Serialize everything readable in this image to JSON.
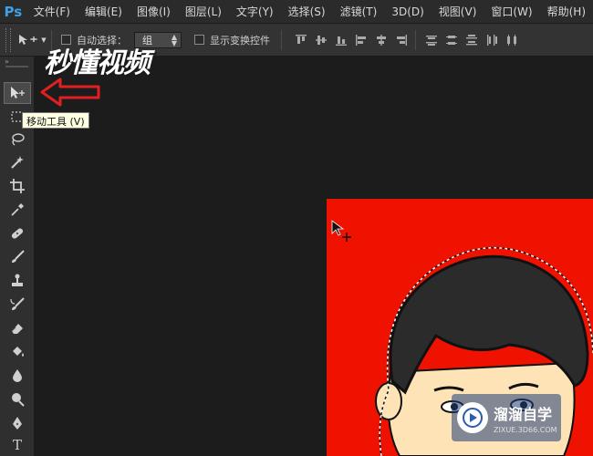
{
  "app": {
    "logo": "Ps",
    "accent": "#3ea0e8"
  },
  "menu": [
    "文件(F)",
    "编辑(E)",
    "图像(I)",
    "图层(L)",
    "文字(Y)",
    "选择(S)",
    "滤镜(T)",
    "3D(D)",
    "视图(V)",
    "窗口(W)",
    "帮助(H)"
  ],
  "options": {
    "auto_select_label": "自动选择：",
    "auto_select_value": "组",
    "show_transform_label": "显示变换控件"
  },
  "tools": [
    {
      "name": "move-tool",
      "icon": "move-icon"
    },
    {
      "name": "marquee-tool",
      "icon": "marquee-icon"
    },
    {
      "name": "lasso-tool",
      "icon": "lasso-icon"
    },
    {
      "name": "magic-wand-tool",
      "icon": "magic-wand-icon"
    },
    {
      "name": "crop-tool",
      "icon": "crop-icon"
    },
    {
      "name": "eyedropper-tool",
      "icon": "eyedropper-icon"
    },
    {
      "name": "healing-brush-tool",
      "icon": "bandage-icon"
    },
    {
      "name": "brush-tool",
      "icon": "brush-icon"
    },
    {
      "name": "clone-stamp-tool",
      "icon": "stamp-icon"
    },
    {
      "name": "history-brush-tool",
      "icon": "history-brush-icon"
    },
    {
      "name": "eraser-tool",
      "icon": "eraser-icon"
    },
    {
      "name": "paint-bucket-tool",
      "icon": "bucket-icon"
    },
    {
      "name": "blur-tool",
      "icon": "drop-icon"
    },
    {
      "name": "dodge-tool",
      "icon": "dodge-icon"
    },
    {
      "name": "pen-tool",
      "icon": "pen-icon"
    },
    {
      "name": "type-tool",
      "icon": "type-icon"
    }
  ],
  "tooltip": "移动工具 (V)",
  "type_tool_label": "T",
  "watermark_top": "秒懂视频",
  "watermark_bottom": {
    "name": "溜溜自学",
    "url": "ZIXUE.3D66.COM"
  },
  "colors": {
    "canvas_bg": "#1c1c1c",
    "document_fill": "#f01200",
    "annotation_arrow": "#e02020",
    "tooltip_bg": "#ffffe1"
  }
}
